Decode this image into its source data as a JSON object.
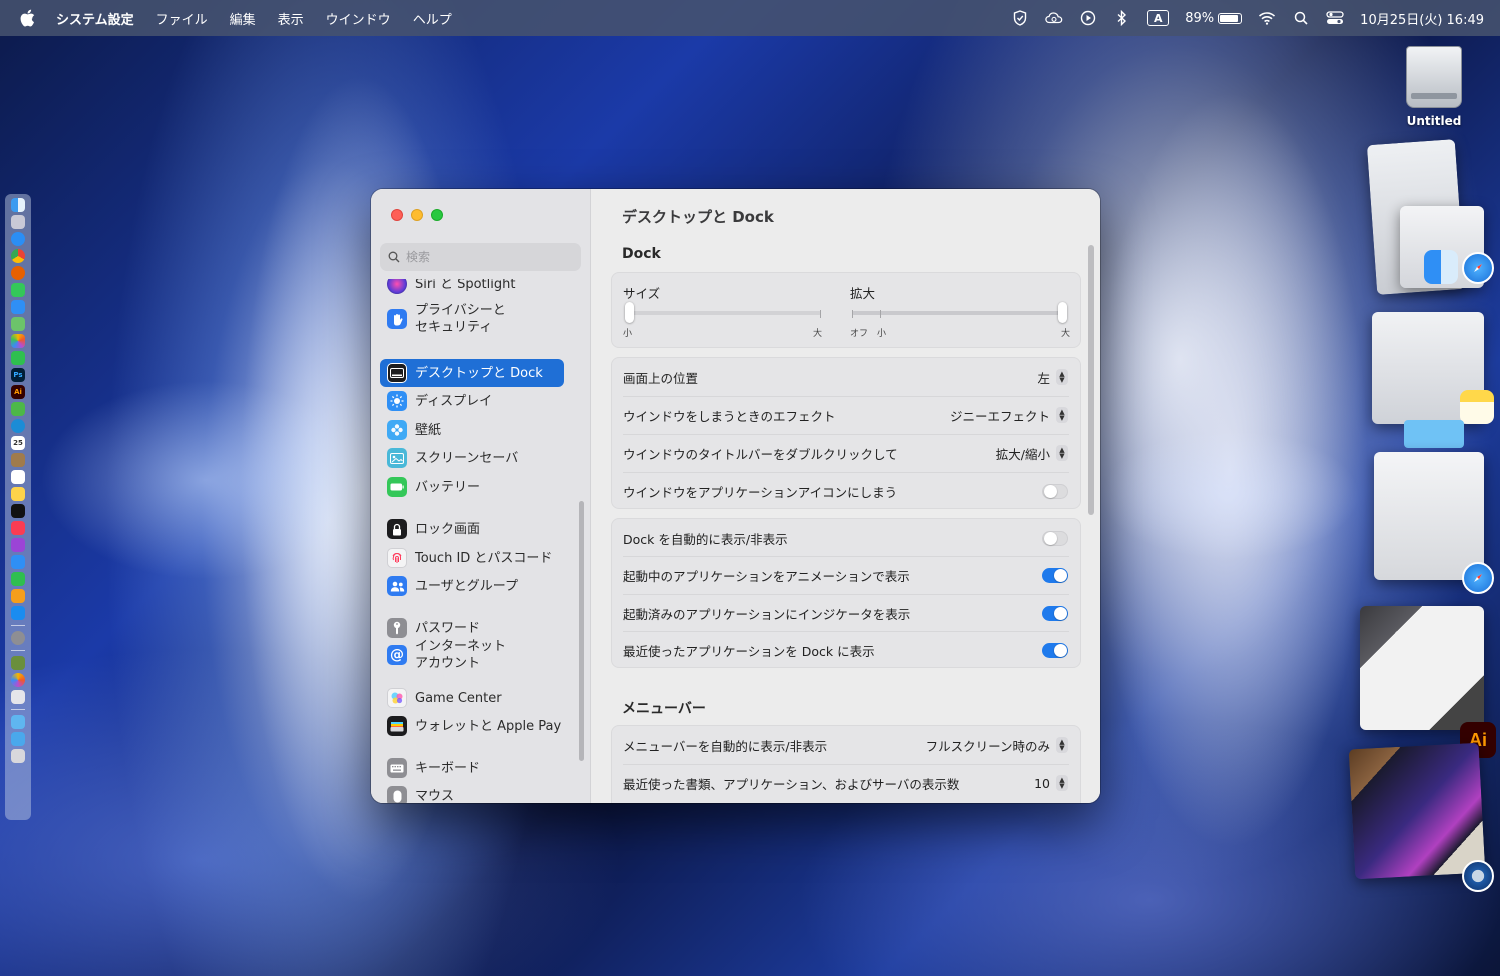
{
  "menubar": {
    "app_name": "システム設定",
    "items": [
      "ファイル",
      "編集",
      "表示",
      "ウインドウ",
      "ヘルプ"
    ],
    "input_mode": "A",
    "battery_percent": "89%",
    "battery_level": 0.89,
    "datetime": "10月25日(火) 16:49"
  },
  "desktop": {
    "disk_label": "Untitled",
    "illustrator_badge": "Ai"
  },
  "window": {
    "search": {
      "placeholder": "検索"
    },
    "sidebar": {
      "items": [
        {
          "label": "Siri と Spotlight",
          "icon": "siri-icon",
          "color": "#8a5cf5"
        },
        {
          "label": "プライバシーと\nセキュリティ",
          "icon": "hand-icon",
          "color": "#2f7bf1"
        },
        {
          "label": "デスクトップと Dock",
          "icon": "dock-icon",
          "color": "#1c1c1e",
          "selected": true
        },
        {
          "label": "ディスプレイ",
          "icon": "display-icon",
          "color": "#2f8ff5"
        },
        {
          "label": "壁紙",
          "icon": "wallpaper-icon",
          "color": "#3fa9f5"
        },
        {
          "label": "スクリーンセーバ",
          "icon": "screensaver-icon",
          "color": "#49b8d8"
        },
        {
          "label": "バッテリー",
          "icon": "battery-icon",
          "color": "#34c759"
        },
        {
          "label": "ロック画面",
          "icon": "lock-icon",
          "color": "#1c1c1e"
        },
        {
          "label": "Touch ID とパスコード",
          "icon": "fingerprint-icon",
          "color": "#f4f4f5"
        },
        {
          "label": "ユーザとグループ",
          "icon": "users-icon",
          "color": "#2f7bf1"
        },
        {
          "label": "パスワード",
          "icon": "key-icon",
          "color": "#8e8e93"
        },
        {
          "label": "インターネット\nアカウント",
          "icon": "at-icon",
          "color": "#2f7bf1"
        },
        {
          "label": "Game Center",
          "icon": "game-center-icon",
          "color": "#f4f4f5"
        },
        {
          "label": "ウォレットと Apple Pay",
          "icon": "wallet-icon",
          "color": "#1c1c1e"
        },
        {
          "label": "キーボード",
          "icon": "keyboard-icon",
          "color": "#8e8e93"
        },
        {
          "label": "マウス",
          "icon": "mouse-icon",
          "color": "#8e8e93"
        }
      ]
    },
    "content": {
      "title": "デスクトップと Dock",
      "dock_section": "Dock",
      "size_slider": {
        "label": "サイズ",
        "min_label": "小",
        "max_label": "大",
        "value": 0.0
      },
      "magnify_slider": {
        "label": "拡大",
        "off_label": "オフ",
        "min_label": "小",
        "max_label": "大",
        "value": 1.0
      },
      "popups": [
        {
          "label": "画面上の位置",
          "value": "左"
        },
        {
          "label": "ウインドウをしまうときのエフェクト",
          "value": "ジニーエフェクト"
        },
        {
          "label": "ウインドウのタイトルバーをダブルクリックして",
          "value": "拡大/縮小"
        }
      ],
      "minimize_to_icon": {
        "label": "ウインドウをアプリケーションアイコンにしまう",
        "on": false
      },
      "toggles": [
        {
          "label": "Dock を自動的に表示/非表示",
          "on": false
        },
        {
          "label": "起動中のアプリケーションをアニメーションで表示",
          "on": true
        },
        {
          "label": "起動済みのアプリケーションにインジケータを表示",
          "on": true
        },
        {
          "label": "最近使ったアプリケーションを Dock に表示",
          "on": true
        }
      ],
      "menubar_section": "メニューバー",
      "menubar_rows": [
        {
          "label": "メニューバーを自動的に表示/非表示",
          "value": "フルスクリーン時のみ"
        },
        {
          "label": "最近使った書類、アプリケーション、およびサーバの表示数",
          "value": "10"
        }
      ]
    }
  },
  "colors": {
    "accent": "#1f7aec",
    "selection": "#1f6fd6",
    "close": "#fe5f57",
    "minimize": "#febc2e",
    "zoom": "#28c840"
  }
}
